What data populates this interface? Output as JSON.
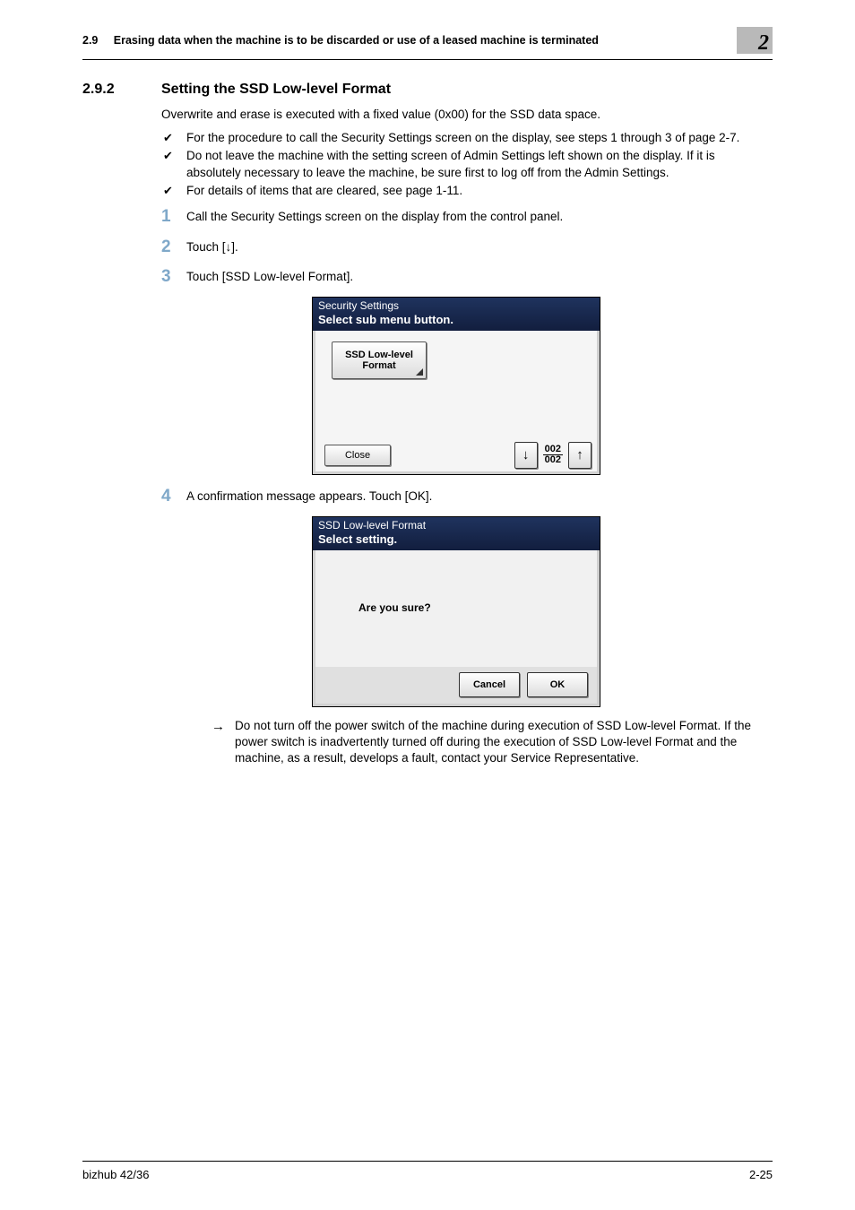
{
  "header": {
    "section_ref": "2.9",
    "section_title": "Erasing data when the machine is to be discarded or use of a leased machine is terminated",
    "chapter_badge": "2"
  },
  "section": {
    "number": "2.9.2",
    "title": "Setting the SSD Low-level Format"
  },
  "intro_para": "Overwrite and erase is executed with a fixed value (0x00) for the SSD data space.",
  "checks": [
    "For the procedure to call the Security Settings screen on the display, see steps 1 through 3 of page 2-7.",
    "Do not leave the machine with the setting screen of Admin Settings left shown on the display. If it is absolutely necessary to leave the machine, be sure first to log off from the Admin Settings.",
    "For details of items that are cleared, see page 1-11."
  ],
  "steps": {
    "s1": {
      "num": "1",
      "text": "Call the Security Settings screen on the display from the control panel."
    },
    "s2": {
      "num": "2",
      "text": "Touch [↓]."
    },
    "s3": {
      "num": "3",
      "text": "Touch [SSD Low-level Format]."
    },
    "s4": {
      "num": "4",
      "text": "A confirmation message appears. Touch [OK]."
    }
  },
  "shot1": {
    "title_line1": "Security Settings",
    "title_line2": "Select sub menu button.",
    "ssd_btn_line1": "SSD Low-level",
    "ssd_btn_line2": "Format",
    "close": "Close",
    "page_top": "002",
    "page_bot": "002",
    "down_arrow": "↓",
    "up_arrow": "↑"
  },
  "shot2": {
    "title_line1": "SSD Low-level Format",
    "title_line2": "Select setting.",
    "confirm_text": "Are you sure?",
    "cancel": "Cancel",
    "ok": "OK"
  },
  "arrow_note": "Do not turn off the power switch of the machine during execution of SSD Low-level Format. If the power switch is inadvertently turned off during the execution of SSD Low-level Format and the machine, as a result, develops a fault, contact your Service Representative.",
  "footer": {
    "left": "bizhub 42/36",
    "right": "2-25"
  }
}
